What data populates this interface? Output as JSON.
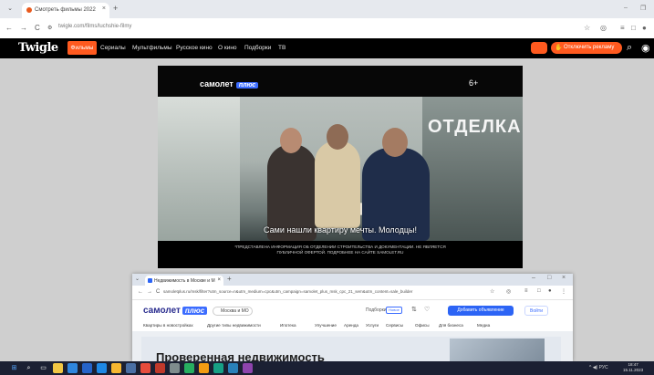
{
  "browser": {
    "menu_glyph": "⌄",
    "tab_title": "Смотреть фильмы 2022",
    "tab_close": "×",
    "new_tab": "+",
    "window_min": "–",
    "window_restore": "❐",
    "back": "←",
    "forward": "→",
    "reload": "C",
    "url": "twigle.com/films/luchshie-filmy",
    "icons": [
      "star-icon",
      "extension-icon",
      "profile-icon"
    ]
  },
  "site": {
    "logo": "Twigle",
    "nav": [
      "Фильмы",
      "Сериалы",
      "Мультфильмы",
      "Русское кино",
      "О кино",
      "Подборки",
      "ТВ"
    ],
    "active_nav": "Фильмы",
    "disable_ads": "Отключить рекламу",
    "accent": "#ff5a1f"
  },
  "video": {
    "brand": "самолет",
    "brand_plus": "плюс",
    "age_rating": "6+",
    "overlay_word": "ОТДЕЛКА",
    "subtitle": "Сами нашли квартиру мечты. Молодцы!",
    "fine_print": "*ПРЕДСТАВЛЕНА ИНФОРМАЦИЯ ОБ ОТДЕЛЕНИИ СТРОИТЕЛЬСТВА И ДОКУМЕНТАЦИИ. НЕ ЯВЛЯЕТСЯ ПУБЛИЧНОЙ ОФЕРТОЙ. ПОДРОБНЕЕ НА САЙТЕ SAMOLET.RU"
  },
  "second_window": {
    "tab_title": "Недвижимость в Москве и М",
    "tab_close": "×",
    "new_tab": "+",
    "window_min": "–",
    "window_max": "□",
    "window_close": "×",
    "url": "samoletplus.ru/msk/filter?utm_source=n&utm_medium=cpc&utm_campaign=samolet_plus_msk_cpc_21_sem&utm_content=sale_builder",
    "brand": "самолет",
    "brand_plus": "плюс",
    "city": "Москва и МО",
    "favorites": "Подборки",
    "badge": "Новое",
    "add_listing": "Добавить объявление",
    "login": "Войти",
    "menu": [
      "Квартиры в новостройках",
      "Другие типы недвижимости",
      "Ипотека",
      "Ипотека",
      "Улучшение",
      "Аренда",
      "Услуги",
      "Сервисы",
      "Офисы",
      "Для бизнеса",
      "Медиа"
    ],
    "headline": "Проверенная недвижимость"
  },
  "taskbar": {
    "apps": [
      "windows-icon",
      "search-icon",
      "taskview-icon",
      "explorer-icon",
      "vscode-icon",
      "outlook-icon",
      "files-icon",
      "calc-icon",
      "chrome-icon",
      "media-icon",
      "photos-icon",
      "teams-icon",
      "maps-icon",
      "store-icon",
      "app-icon",
      "skype-icon",
      "settings-icon"
    ],
    "tray_text": "^ ◀) РУС",
    "time": "18:47",
    "date": "15.11.2023"
  }
}
